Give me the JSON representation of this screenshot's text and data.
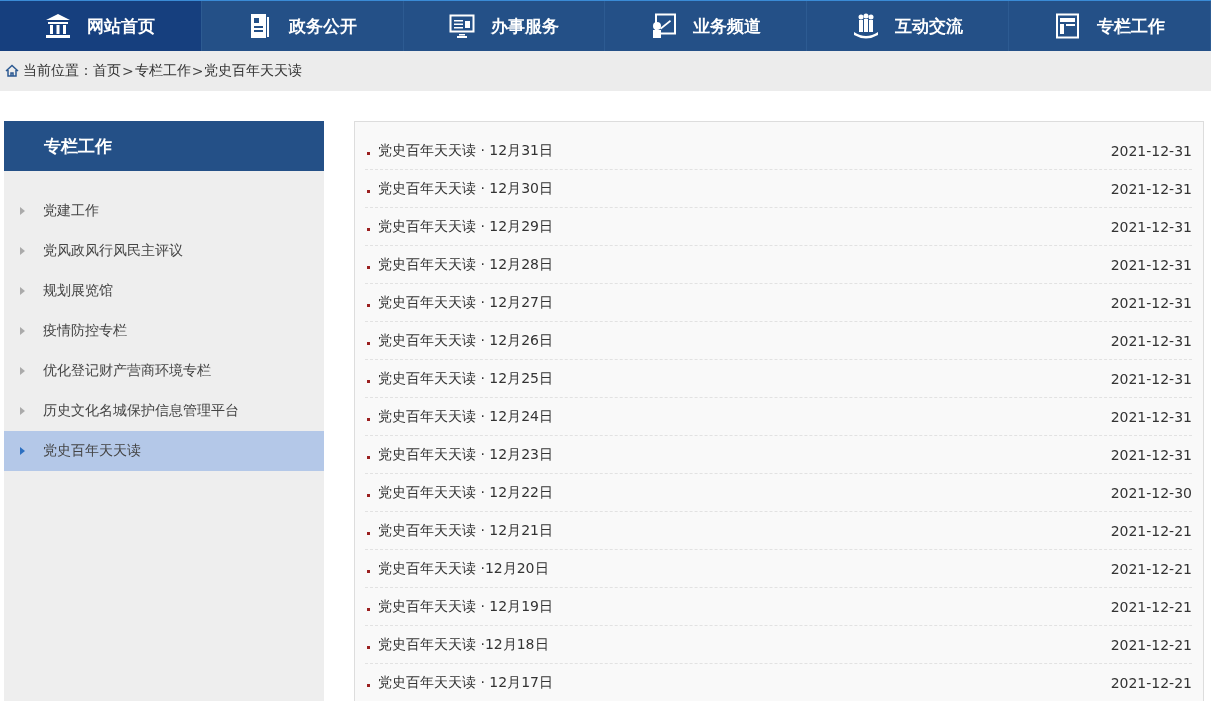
{
  "nav": [
    {
      "label": "网站首页",
      "selected": true
    },
    {
      "label": "政务公开",
      "selected": false
    },
    {
      "label": "办事服务",
      "selected": false
    },
    {
      "label": "业务频道",
      "selected": false
    },
    {
      "label": "互动交流",
      "selected": false
    },
    {
      "label": "专栏工作",
      "selected": false
    }
  ],
  "breadcrumb": {
    "label": "当前位置：",
    "trail": [
      {
        "kind": "link",
        "text": "首页"
      },
      {
        "kind": "separator",
        "text": ">"
      },
      {
        "kind": "link",
        "text": "专栏工作"
      },
      {
        "kind": "separator",
        "text": ">"
      },
      {
        "kind": "link",
        "text": "党史百年天天读"
      }
    ]
  },
  "sidebar": {
    "title": "专栏工作",
    "items": [
      {
        "label": "党建工作",
        "selected": false
      },
      {
        "label": "党风政风行风民主评议",
        "selected": false
      },
      {
        "label": "规划展览馆",
        "selected": false
      },
      {
        "label": "疫情防控专栏",
        "selected": false
      },
      {
        "label": "优化登记财产营商环境专栏",
        "selected": false
      },
      {
        "label": "历史文化名城保护信息管理平台",
        "selected": false
      },
      {
        "label": "党史百年天天读",
        "selected": true
      }
    ]
  },
  "articles": [
    {
      "title": "党史百年天天读 · 12月31日",
      "date": "2021-12-31"
    },
    {
      "title": "党史百年天天读 · 12月30日",
      "date": "2021-12-31"
    },
    {
      "title": "党史百年天天读 · 12月29日",
      "date": "2021-12-31"
    },
    {
      "title": "党史百年天天读 · 12月28日",
      "date": "2021-12-31"
    },
    {
      "title": "党史百年天天读 · 12月27日",
      "date": "2021-12-31"
    },
    {
      "title": "党史百年天天读 · 12月26日",
      "date": "2021-12-31"
    },
    {
      "title": "党史百年天天读 · 12月25日",
      "date": "2021-12-31"
    },
    {
      "title": "党史百年天天读 · 12月24日",
      "date": "2021-12-31"
    },
    {
      "title": "党史百年天天读 · 12月23日",
      "date": "2021-12-31"
    },
    {
      "title": "党史百年天天读 · 12月22日",
      "date": "2021-12-30"
    },
    {
      "title": "党史百年天天读 · 12月21日",
      "date": "2021-12-21"
    },
    {
      "title": "党史百年天天读 ·12月20日",
      "date": "2021-12-21"
    },
    {
      "title": "党史百年天天读 · 12月19日",
      "date": "2021-12-21"
    },
    {
      "title": "党史百年天天读 ·12月18日",
      "date": "2021-12-21"
    },
    {
      "title": "党史百年天天读 · 12月17日",
      "date": "2021-12-21"
    }
  ]
}
